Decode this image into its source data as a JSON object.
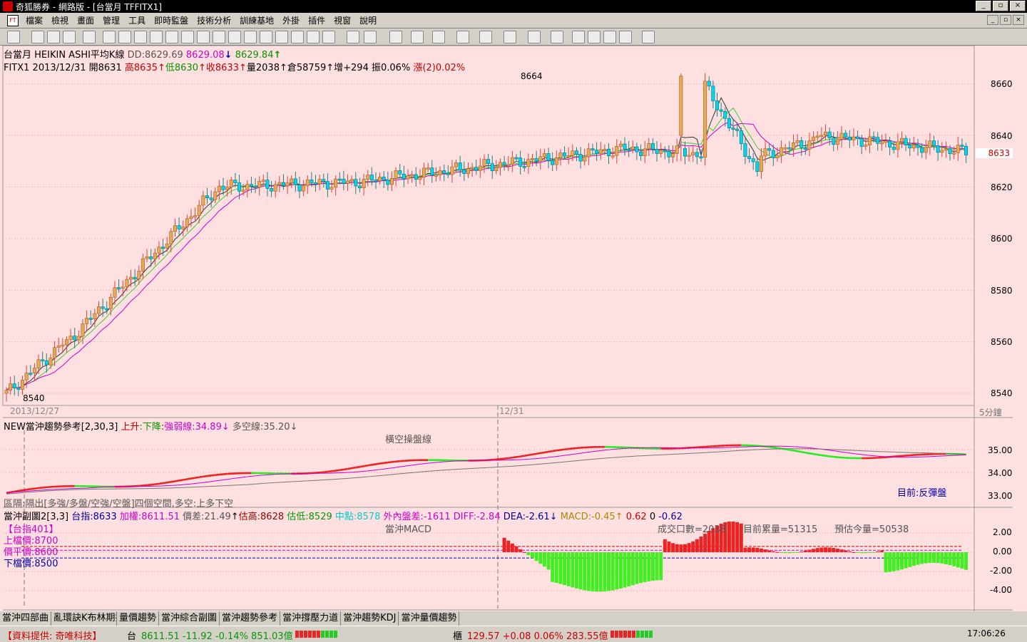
{
  "window": {
    "title": "奇狐勝券 - 網路版 - [台當月 TFFITX1]",
    "controls": [
      "_",
      "▫",
      "×"
    ]
  },
  "menu": [
    "檔案",
    "檢視",
    "畫面",
    "管理",
    "工具",
    "即時監盤",
    "技術分析",
    "訓練基地",
    "外掛",
    "插件",
    "視窗",
    "說明"
  ],
  "mdi_controls": [
    "_",
    "▫",
    "×"
  ],
  "colors": {
    "bg": "#ffe0e0",
    "up": "#e8a858",
    "down": "#00c8e0",
    "green": "#22cc22",
    "red": "#ee2222"
  },
  "main": {
    "title": "台當月 HEIKIN ASHI平均K線",
    "dd": "DD:8629.69",
    "v1": "8629.08",
    "v2": "8629.84",
    "info": {
      "sym": "FITX1 2013/12/31",
      "open": "開8631",
      "high": "高8635",
      "low": "低8630",
      "close": "收8633",
      "vol": "量2038",
      "oi": "倉58759",
      "inc": "增+294",
      "amp": "振0.06%",
      "chg": "漲(2)0.02%"
    },
    "price_axis": [
      "8660",
      "8640",
      "8620",
      "8600",
      "8580",
      "8560",
      "8540"
    ],
    "current_price": "8633",
    "hi_label": "8664",
    "lo_label": "8540",
    "date1": "2013/12/27",
    "date2": "12/31",
    "period": "5分鐘"
  },
  "ind1": {
    "name": "NEW當沖趨勢參考",
    "params": "[2,30,3]",
    "up": "上升",
    "down": "下降",
    "weak": "強弱線:34.89",
    "ls": "多空線:35.20",
    "mid_label": "橫空操盤線",
    "note": "區隔:隔出[多強/多盤/空強/空盤]四個空間,多空:上多下空",
    "status": "目前:反彈盤",
    "axis": [
      "35.00",
      "34.00",
      "33.00"
    ]
  },
  "ind2": {
    "name": "當沖副圖2",
    "params": "[3,3]",
    "idx": "台指:8633",
    "wgt": "加權:8611.51",
    "diff": "價差:21.49",
    "high": "估高:8628",
    "low": "估低:8529",
    "mid": "中點:8578",
    "io": "外內盤差:-1611",
    "d": "DIFF:-2.84",
    "dea": "DEA:-2.61",
    "macd": "MACD:-0.45",
    "m1": "0.62",
    "m2": "0",
    "m3": "-0.62",
    "title": "當沖MACD",
    "vol_info": "成交口數=2038",
    "acc": "目前累量=51315",
    "est": "預估今量=50538",
    "box_title": "【台指401】",
    "up_price": "上檔價:8700",
    "flat": "價平價:8600",
    "dn_price": "下檔價:8500",
    "axis": [
      "2.00",
      "0.00",
      "-2.00",
      "-4.00"
    ]
  },
  "tabs": [
    "當沖四部曲",
    "亂環訣K布林期指",
    "量價趨勢",
    "當沖綜合副圖",
    "當沖趨勢參考",
    "當沖撐壓力道",
    "當沖趨勢KDJ",
    "當沖量價趨勢"
  ],
  "status": {
    "provider": "【資料提供: 奇唯科技】",
    "tw_label": "台",
    "tw": "8611.51 -11.92 -0.14% 851.03億",
    "otc_label": "櫃",
    "otc": "129.57 +0.08 0.06% 283.55億",
    "time": "17:06:26"
  }
}
